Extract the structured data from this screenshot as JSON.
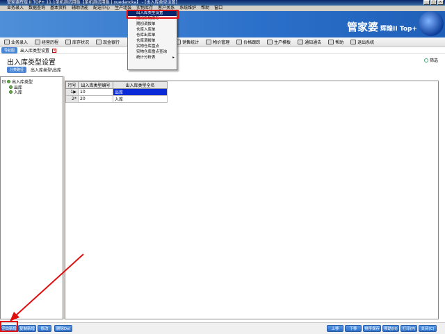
{
  "window": {
    "title": "管家婆辉煌 II  TOP+ 11.1单机测试用版【单机测试用版 | xuedancka】 - [出入库类型设置]",
    "controls": [
      "_",
      "□",
      "×"
    ]
  },
  "menubar": [
    "业务录入",
    "数据查询",
    "基本资料",
    "辅助功能",
    "配送中心",
    "生产组装",
    "实物库存",
    "客户关系",
    "系统维护",
    "帮助",
    "窗口"
  ],
  "brand": {
    "name": "管家婆",
    "edition": "辉煌II Top+"
  },
  "toolbar": [
    {
      "label": "业务录入",
      "icon": "pencil-icon"
    },
    {
      "label": "经营历程",
      "icon": "chart-icon"
    },
    {
      "label": "库存状况",
      "icon": "grid-icon"
    },
    {
      "label": "现金银行",
      "icon": "cash-icon"
    },
    {
      "label": "销售统计",
      "icon": "stats-icon"
    },
    {
      "label": "物价管理",
      "icon": "balance-icon"
    },
    {
      "label": "价格跟踪",
      "icon": "trend-icon"
    },
    {
      "label": "生产模板",
      "icon": "tools-icon"
    },
    {
      "label": "通知通告",
      "icon": "notice-icon"
    },
    {
      "label": "帮助",
      "icon": "info-icon"
    },
    {
      "label": "退出系统",
      "icon": "exit-icon"
    }
  ],
  "dropdown": {
    "items": [
      {
        "label": "出入库类型设置",
        "selected": true
      },
      {
        "label": "期初实物库存",
        "selected": false
      },
      {
        "label": "期初调拨单",
        "selected": false
      },
      {
        "label": "仓库入库单",
        "selected": false
      },
      {
        "label": "仓库出库单",
        "selected": false
      },
      {
        "label": "仓库调拨单",
        "selected": false
      },
      {
        "label": "实物仓库盘点",
        "selected": false
      },
      {
        "label": "实物仓库盘点查询",
        "selected": false
      },
      {
        "label": "统计分析表",
        "selected": false,
        "submenu": true
      }
    ]
  },
  "tabs": {
    "nav": "导航图",
    "current": "出入库类型设置",
    "close": "×"
  },
  "page": {
    "title": "出入库类型设置",
    "filter_label": "筛选",
    "crumb_button": "分类路径",
    "crumb_path": "出入库类型\\出库"
  },
  "tree": {
    "root": "出入库类型",
    "children": [
      "出库",
      "入库"
    ]
  },
  "grid": {
    "headers": [
      "行号",
      "出入库类型编号",
      "出入库类型全名"
    ],
    "rows": [
      {
        "no": "1",
        "marker": "▶",
        "code": "10",
        "name": "出库",
        "selected": true
      },
      {
        "no": "2",
        "marker": "*",
        "code": "20",
        "name": "入库",
        "selected": false
      }
    ]
  },
  "bottom_buttons": {
    "left": [
      "空白新增",
      "复制新增",
      "修改",
      "删除Del"
    ],
    "right": [
      "上移",
      "下移",
      "排序保存",
      "帮助(H)",
      "打印(P)",
      "关闭(C)"
    ]
  },
  "colors": {
    "banner": "#2a6fc9",
    "highlight": "#e01010",
    "selection": "#0a2ad8"
  }
}
